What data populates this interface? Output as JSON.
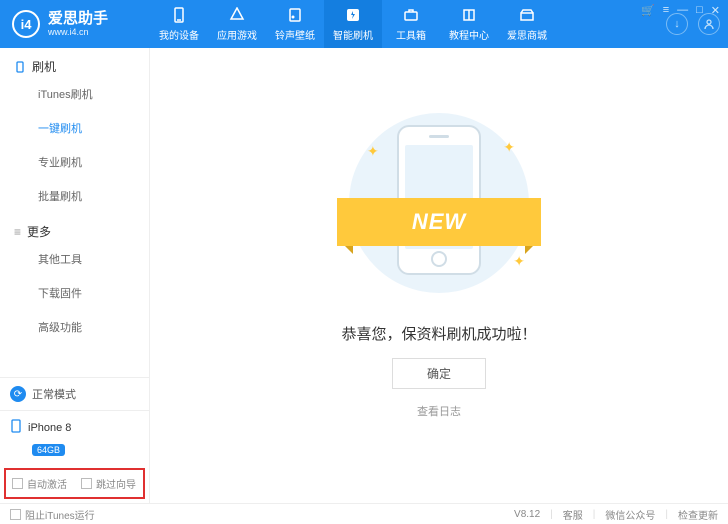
{
  "brand": {
    "name": "爱思助手",
    "sub": "www.i4.cn",
    "logo": "i4"
  },
  "nav": {
    "items": [
      {
        "label": "我的设备",
        "icon": "phone"
      },
      {
        "label": "应用游戏",
        "icon": "app"
      },
      {
        "label": "铃声壁纸",
        "icon": "music"
      },
      {
        "label": "智能刷机",
        "icon": "flash",
        "active": true
      },
      {
        "label": "工具箱",
        "icon": "toolbox"
      },
      {
        "label": "教程中心",
        "icon": "book"
      },
      {
        "label": "爱思商城",
        "icon": "store"
      }
    ]
  },
  "sidebar": {
    "group1": {
      "title": "刷机"
    },
    "items1": [
      {
        "label": "iTunes刷机"
      },
      {
        "label": "一键刷机",
        "active": true
      },
      {
        "label": "专业刷机"
      },
      {
        "label": "批量刷机"
      }
    ],
    "group2": {
      "title": "更多"
    },
    "items2": [
      {
        "label": "其他工具"
      },
      {
        "label": "下载固件"
      },
      {
        "label": "高级功能"
      }
    ],
    "mode": "正常模式",
    "device": {
      "name": "iPhone 8",
      "storage": "64GB"
    },
    "auto_activate": "自动激活",
    "skip_guide": "跳过向导"
  },
  "main": {
    "ribbon": "NEW",
    "success": "恭喜您，保资料刷机成功啦！",
    "ok": "确定",
    "view_log": "查看日志"
  },
  "status": {
    "block_itunes": "阻止iTunes运行",
    "version": "V8.12",
    "support": "客服",
    "wechat": "微信公众号",
    "update": "检查更新"
  }
}
